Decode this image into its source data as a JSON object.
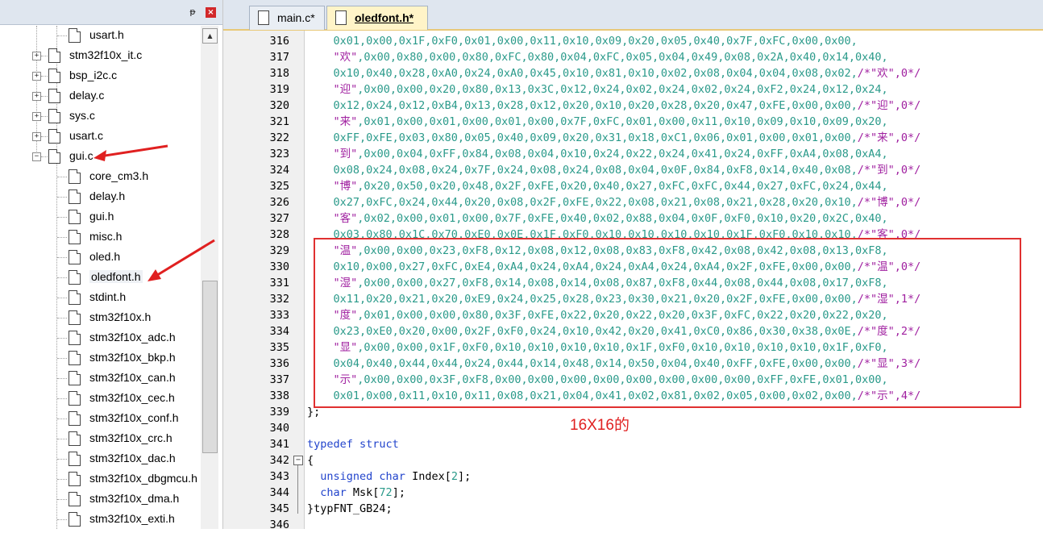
{
  "project_tree": {
    "pin_glyph": "ᵽ",
    "close_glyph": "×",
    "scroll_up_glyph": "▲",
    "items": [
      {
        "label": "usart.h",
        "expandable": false,
        "indent": 1
      },
      {
        "label": "stm32f10x_it.c",
        "expandable": true,
        "expanded": false,
        "indent": 0
      },
      {
        "label": "bsp_i2c.c",
        "expandable": true,
        "expanded": false,
        "indent": 0
      },
      {
        "label": "delay.c",
        "expandable": true,
        "expanded": false,
        "indent": 0
      },
      {
        "label": "sys.c",
        "expandable": true,
        "expanded": false,
        "indent": 0
      },
      {
        "label": "usart.c",
        "expandable": true,
        "expanded": false,
        "indent": 0
      },
      {
        "label": "gui.c",
        "expandable": true,
        "expanded": true,
        "indent": 0
      },
      {
        "label": "core_cm3.h",
        "expandable": false,
        "indent": 1
      },
      {
        "label": "delay.h",
        "expandable": false,
        "indent": 1
      },
      {
        "label": "gui.h",
        "expandable": false,
        "indent": 1
      },
      {
        "label": "misc.h",
        "expandable": false,
        "indent": 1
      },
      {
        "label": "oled.h",
        "expandable": false,
        "indent": 1
      },
      {
        "label": "oledfont.h",
        "expandable": false,
        "indent": 1,
        "selected": true
      },
      {
        "label": "stdint.h",
        "expandable": false,
        "indent": 1
      },
      {
        "label": "stm32f10x.h",
        "expandable": false,
        "indent": 1
      },
      {
        "label": "stm32f10x_adc.h",
        "expandable": false,
        "indent": 1
      },
      {
        "label": "stm32f10x_bkp.h",
        "expandable": false,
        "indent": 1
      },
      {
        "label": "stm32f10x_can.h",
        "expandable": false,
        "indent": 1
      },
      {
        "label": "stm32f10x_cec.h",
        "expandable": false,
        "indent": 1
      },
      {
        "label": "stm32f10x_conf.h",
        "expandable": false,
        "indent": 1
      },
      {
        "label": "stm32f10x_crc.h",
        "expandable": false,
        "indent": 1
      },
      {
        "label": "stm32f10x_dac.h",
        "expandable": false,
        "indent": 1
      },
      {
        "label": "stm32f10x_dbgmcu.h",
        "expandable": false,
        "indent": 1
      },
      {
        "label": "stm32f10x_dma.h",
        "expandable": false,
        "indent": 1
      },
      {
        "label": "stm32f10x_exti.h",
        "expandable": false,
        "indent": 1
      }
    ]
  },
  "tabs": [
    {
      "label": "main.c*",
      "active": false
    },
    {
      "label": "oledfont.h*",
      "active": true
    }
  ],
  "editor": {
    "lines": [
      {
        "n": "316",
        "fold": "",
        "t": [
          [
            "hex",
            "    0x01,0x00,0x1F,0xF0,0x01,0x00,0x11,0x10,0x09,0x20,0x05,0x40,0x7F,0xFC,0x00,0x00,"
          ]
        ]
      },
      {
        "n": "317",
        "fold": "",
        "t": [
          [
            "str",
            "    \"欢\""
          ],
          [
            "hex",
            ",0x00,0x80,0x00,0x80,0xFC,0x80,0x04,0xFC,0x05,0x04,0x49,0x08,0x2A,0x40,0x14,0x40,"
          ]
        ]
      },
      {
        "n": "318",
        "fold": "",
        "t": [
          [
            "hex",
            "    0x10,0x40,0x28,0xA0,0x24,0xA0,0x45,0x10,0x81,0x10,0x02,0x08,0x04,0x04,0x08,0x02,"
          ],
          [
            "str",
            "/*\"欢\",0*/"
          ]
        ]
      },
      {
        "n": "319",
        "fold": "",
        "t": [
          [
            "str",
            "    \"迎\""
          ],
          [
            "hex",
            ",0x00,0x00,0x20,0x80,0x13,0x3C,0x12,0x24,0x02,0x24,0x02,0x24,0xF2,0x24,0x12,0x24,"
          ]
        ]
      },
      {
        "n": "320",
        "fold": "",
        "t": [
          [
            "hex",
            "    0x12,0x24,0x12,0xB4,0x13,0x28,0x12,0x20,0x10,0x20,0x28,0x20,0x47,0xFE,0x00,0x00,"
          ],
          [
            "str",
            "/*\"迎\",0*/"
          ]
        ]
      },
      {
        "n": "321",
        "fold": "",
        "t": [
          [
            "str",
            "    \"来\""
          ],
          [
            "hex",
            ",0x01,0x00,0x01,0x00,0x01,0x00,0x7F,0xFC,0x01,0x00,0x11,0x10,0x09,0x10,0x09,0x20,"
          ]
        ]
      },
      {
        "n": "322",
        "fold": "",
        "t": [
          [
            "hex",
            "    0xFF,0xFE,0x03,0x80,0x05,0x40,0x09,0x20,0x31,0x18,0xC1,0x06,0x01,0x00,0x01,0x00,"
          ],
          [
            "str",
            "/*\"来\",0*/"
          ]
        ]
      },
      {
        "n": "323",
        "fold": "",
        "t": [
          [
            "str",
            "    \"到\""
          ],
          [
            "hex",
            ",0x00,0x04,0xFF,0x84,0x08,0x04,0x10,0x24,0x22,0x24,0x41,0x24,0xFF,0xA4,0x08,0xA4,"
          ]
        ]
      },
      {
        "n": "324",
        "fold": "",
        "t": [
          [
            "hex",
            "    0x08,0x24,0x08,0x24,0x7F,0x24,0x08,0x24,0x08,0x04,0x0F,0x84,0xF8,0x14,0x40,0x08,"
          ],
          [
            "str",
            "/*\"到\",0*/"
          ]
        ]
      },
      {
        "n": "325",
        "fold": "",
        "t": [
          [
            "str",
            "    \"博\""
          ],
          [
            "hex",
            ",0x20,0x50,0x20,0x48,0x2F,0xFE,0x20,0x40,0x27,0xFC,0xFC,0x44,0x27,0xFC,0x24,0x44,"
          ]
        ]
      },
      {
        "n": "326",
        "fold": "",
        "t": [
          [
            "hex",
            "    0x27,0xFC,0x24,0x44,0x20,0x08,0x2F,0xFE,0x22,0x08,0x21,0x08,0x21,0x28,0x20,0x10,"
          ],
          [
            "str",
            "/*\"博\",0*/"
          ]
        ]
      },
      {
        "n": "327",
        "fold": "",
        "t": [
          [
            "str",
            "    \"客\""
          ],
          [
            "hex",
            ",0x02,0x00,0x01,0x00,0x7F,0xFE,0x40,0x02,0x88,0x04,0x0F,0xF0,0x10,0x20,0x2C,0x40,"
          ]
        ]
      },
      {
        "n": "328",
        "fold": "",
        "t": [
          [
            "hex",
            "    0x03,0x80,0x1C,0x70,0xE0,0x0E,0x1F,0xF0,0x10,0x10,0x10,0x10,0x1F,0xF0,0x10,0x10,"
          ],
          [
            "str",
            "/*\"客\",0*/"
          ]
        ]
      },
      {
        "n": "329",
        "fold": "",
        "t": [
          [
            "str",
            "    \"温\""
          ],
          [
            "hex",
            ",0x00,0x00,0x23,0xF8,0x12,0x08,0x12,0x08,0x83,0xF8,0x42,0x08,0x42,0x08,0x13,0xF8,"
          ]
        ]
      },
      {
        "n": "330",
        "fold": "",
        "t": [
          [
            "hex",
            "    0x10,0x00,0x27,0xFC,0xE4,0xA4,0x24,0xA4,0x24,0xA4,0x24,0xA4,0x2F,0xFE,0x00,0x00,"
          ],
          [
            "str",
            "/*\"温\",0*/"
          ]
        ]
      },
      {
        "n": "331",
        "fold": "",
        "t": [
          [
            "str",
            "    \"湿\""
          ],
          [
            "hex",
            ",0x00,0x00,0x27,0xF8,0x14,0x08,0x14,0x08,0x87,0xF8,0x44,0x08,0x44,0x08,0x17,0xF8,"
          ]
        ]
      },
      {
        "n": "332",
        "fold": "",
        "t": [
          [
            "hex",
            "    0x11,0x20,0x21,0x20,0xE9,0x24,0x25,0x28,0x23,0x30,0x21,0x20,0x2F,0xFE,0x00,0x00,"
          ],
          [
            "str",
            "/*\"湿\",1*/"
          ]
        ]
      },
      {
        "n": "333",
        "fold": "",
        "t": [
          [
            "str",
            "    \"度\""
          ],
          [
            "hex",
            ",0x01,0x00,0x00,0x80,0x3F,0xFE,0x22,0x20,0x22,0x20,0x3F,0xFC,0x22,0x20,0x22,0x20,"
          ]
        ]
      },
      {
        "n": "334",
        "fold": "",
        "t": [
          [
            "hex",
            "    0x23,0xE0,0x20,0x00,0x2F,0xF0,0x24,0x10,0x42,0x20,0x41,0xC0,0x86,0x30,0x38,0x0E,"
          ],
          [
            "str",
            "/*\"度\",2*/"
          ]
        ]
      },
      {
        "n": "335",
        "fold": "",
        "t": [
          [
            "str",
            "    \"显\""
          ],
          [
            "hex",
            ",0x00,0x00,0x1F,0xF0,0x10,0x10,0x10,0x10,0x1F,0xF0,0x10,0x10,0x10,0x10,0x1F,0xF0,"
          ]
        ]
      },
      {
        "n": "336",
        "fold": "",
        "t": [
          [
            "hex",
            "    0x04,0x40,0x44,0x44,0x24,0x44,0x14,0x48,0x14,0x50,0x04,0x40,0xFF,0xFE,0x00,0x00,"
          ],
          [
            "str",
            "/*\"显\",3*/"
          ]
        ]
      },
      {
        "n": "337",
        "fold": "",
        "t": [
          [
            "str",
            "    \"示\""
          ],
          [
            "hex",
            ",0x00,0x00,0x3F,0xF8,0x00,0x00,0x00,0x00,0x00,0x00,0x00,0x00,0xFF,0xFE,0x01,0x00,"
          ]
        ]
      },
      {
        "n": "338",
        "fold": "",
        "t": [
          [
            "hex",
            "    0x01,0x00,0x11,0x10,0x11,0x08,0x21,0x04,0x41,0x02,0x81,0x02,0x05,0x00,0x02,0x00,"
          ],
          [
            "str",
            "/*\"示\",4*/"
          ]
        ]
      },
      {
        "n": "339",
        "fold": "",
        "t": [
          [
            "pl",
            "};"
          ]
        ]
      },
      {
        "n": "340",
        "fold": "",
        "t": [
          [
            "pl",
            ""
          ]
        ]
      },
      {
        "n": "341",
        "fold": "",
        "t": [
          [
            "kw",
            "typedef struct"
          ]
        ]
      },
      {
        "n": "342",
        "fold": "−",
        "t": [
          [
            "pl",
            "{"
          ]
        ]
      },
      {
        "n": "343",
        "fold": "",
        "t": [
          [
            "pl",
            "  "
          ],
          [
            "kw",
            "unsigned char"
          ],
          [
            "pl",
            " Index["
          ],
          [
            "hex",
            "2"
          ],
          [
            "pl",
            "];"
          ]
        ]
      },
      {
        "n": "344",
        "fold": "",
        "t": [
          [
            "pl",
            "  "
          ],
          [
            "kw",
            "char"
          ],
          [
            "pl",
            " Msk["
          ],
          [
            "hex",
            "72"
          ],
          [
            "pl",
            "];"
          ]
        ]
      },
      {
        "n": "345",
        "fold": "",
        "t": [
          [
            "pl",
            "}typFNT_GB24;"
          ]
        ]
      },
      {
        "n": "346",
        "fold": "",
        "t": [
          [
            "pl",
            ""
          ]
        ]
      }
    ]
  },
  "annotation": {
    "text": "16X16的",
    "color": "#e02020"
  },
  "colors": {
    "hex": "#2a9a8a",
    "string": "#a020a0",
    "keyword": "#2244cc",
    "highlight_box": "#e03030"
  }
}
